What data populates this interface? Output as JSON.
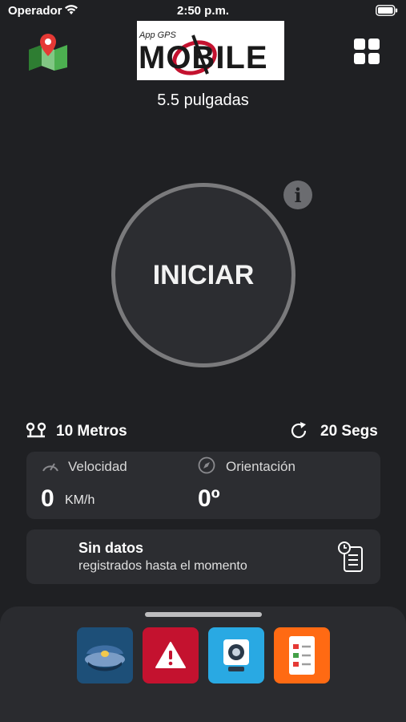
{
  "status_bar": {
    "carrier": "Operador",
    "time": "2:50 p.m.",
    "icons": [
      "wifi-icon",
      "battery-icon"
    ]
  },
  "header": {
    "logo_small": "App GPS",
    "logo_big": "MOBILE",
    "left_icon": "maps-icon",
    "right_icon": "grid-icon",
    "device_size": "5.5 pulgadas"
  },
  "main": {
    "start_label": "INICIAR",
    "info_label": "i"
  },
  "settings": {
    "distance": "10 Metros",
    "interval": "20 Segs"
  },
  "metrics": {
    "speed_label": "Velocidad",
    "speed_value": "0",
    "speed_unit": "KM/h",
    "orientation_label": "Orientación",
    "orientation_value": "0º"
  },
  "history": {
    "title": "Sin datos",
    "subtitle": "registrados hasta el momento"
  },
  "dock": {
    "apps": [
      "police-app",
      "alert-app",
      "camera-app",
      "report-app"
    ]
  },
  "colors": {
    "background": "#1f2023",
    "card": "#2c2d31",
    "ring": "#7a7a7c",
    "police": "#1d4f78",
    "alert": "#c4122f",
    "camera": "#29a9e3",
    "report": "#ff6a13"
  }
}
